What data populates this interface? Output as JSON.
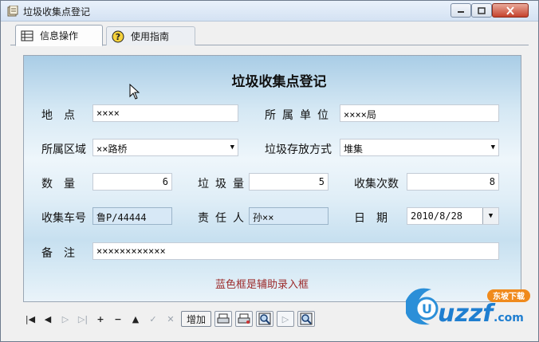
{
  "window": {
    "title": "垃圾收集点登记"
  },
  "tabs": [
    {
      "label": "信息操作",
      "icon": "table-icon",
      "active": true
    },
    {
      "label": "使用指南",
      "icon": "help-icon",
      "active": false
    }
  ],
  "form": {
    "title": "垃圾收集点登记",
    "location": {
      "label": "地　点",
      "value": "××××"
    },
    "unit": {
      "label": "所属单位",
      "value": "××××局"
    },
    "area": {
      "label": "所属区域",
      "value": "××路桥"
    },
    "storage": {
      "label": "垃圾存放方式",
      "value": "堆集"
    },
    "quantity": {
      "label": "数　量",
      "value": "6"
    },
    "garbage_amount": {
      "label": "垃圾量",
      "value": "5"
    },
    "collect_times": {
      "label": "收集次数",
      "value": "8"
    },
    "vehicle": {
      "label": "收集车号",
      "value": "鲁P/44444"
    },
    "person": {
      "label": "责任人",
      "value": "孙××"
    },
    "date": {
      "label": "日　期",
      "value": "2010/8/28"
    },
    "remark": {
      "label": "备　注",
      "value": "××××××××××××"
    },
    "hint": "蓝色框是辅助录入框"
  },
  "navbar": {
    "add_label": "增加"
  },
  "watermark": {
    "text": "uzzf.com",
    "badge": "东坡下载"
  },
  "colors": {
    "hint": "#9c2a2a",
    "assist_field": "#d7e8f6",
    "close_button": "#c5422d"
  }
}
